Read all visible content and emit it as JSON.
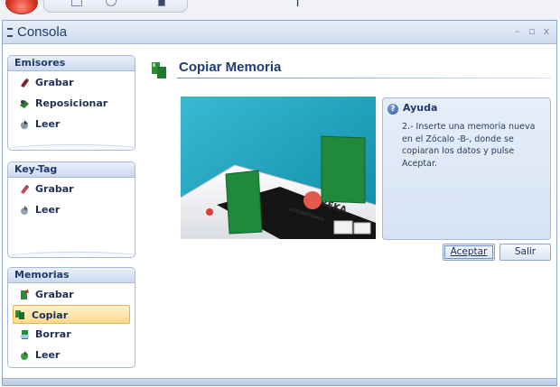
{
  "window": {
    "title": "Consola",
    "top_title_fragment": "i"
  },
  "sidebar": {
    "groups": [
      {
        "title": "Emisores",
        "items": [
          {
            "label": "Grabar",
            "icon": "record-icon"
          },
          {
            "label": "Reposicionar",
            "icon": "reposition-icon"
          },
          {
            "label": "Leer",
            "icon": "read-icon"
          }
        ]
      },
      {
        "title": "Key-Tag",
        "items": [
          {
            "label": "Grabar",
            "icon": "record-icon"
          },
          {
            "label": "Leer",
            "icon": "read-icon"
          }
        ]
      },
      {
        "title": "Memorias",
        "items": [
          {
            "label": "Grabar",
            "icon": "record-icon"
          },
          {
            "label": "Copiar",
            "icon": "copy-icon",
            "selected": true
          },
          {
            "label": "Borrar",
            "icon": "erase-icon"
          },
          {
            "label": "Leer",
            "icon": "read-icon"
          }
        ]
      }
    ]
  },
  "main": {
    "title": "Copiar Memoria",
    "photo_brand": "REKA",
    "photo_caption": "AUTOMATISMOS"
  },
  "help": {
    "title": "Ayuda",
    "text": "2.- Inserte una memoria nueva en el Zócalo -B-, donde se copiaran los datos y pulse Aceptar."
  },
  "buttons": {
    "accept": "Aceptar",
    "exit": "Salir"
  },
  "colors": {
    "accent": "#1f3c6e",
    "panel_border": "#a6bad8",
    "selected_bg": "#fcd98a",
    "memory_green": "#1f8a3b"
  }
}
